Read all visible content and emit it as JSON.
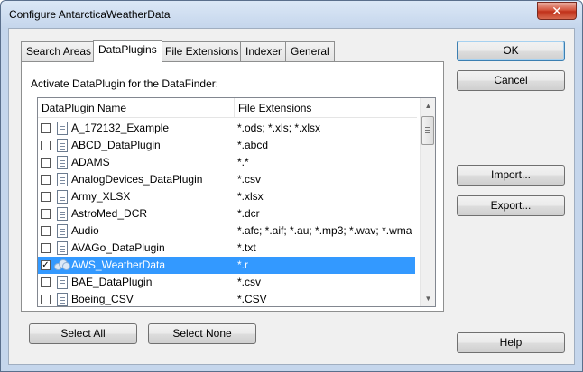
{
  "window": {
    "title": "Configure AntarcticaWeatherData",
    "close_glyph": "✕"
  },
  "tabs": [
    {
      "label": "Search Areas",
      "active": false
    },
    {
      "label": "DataPlugins",
      "active": true
    },
    {
      "label": "File Extensions",
      "active": false
    },
    {
      "label": "Indexer",
      "active": false
    },
    {
      "label": "General",
      "active": false
    }
  ],
  "panel": {
    "label": "Activate DataPlugin for the DataFinder:",
    "columns": {
      "name": "DataPlugin Name",
      "extensions": "File Extensions"
    },
    "rows": [
      {
        "name": "A_172132_Example",
        "ext": "*.ods; *.xls; *.xlsx",
        "checked": false,
        "selected": false,
        "icon": "document-icon"
      },
      {
        "name": "ABCD_DataPlugin",
        "ext": "*.abcd",
        "checked": false,
        "selected": false,
        "icon": "document-icon"
      },
      {
        "name": "ADAMS",
        "ext": "*.*",
        "checked": false,
        "selected": false,
        "icon": "document-icon"
      },
      {
        "name": "AnalogDevices_DataPlugin",
        "ext": "*.csv",
        "checked": false,
        "selected": false,
        "icon": "document-icon"
      },
      {
        "name": "Army_XLSX",
        "ext": "*.xlsx",
        "checked": false,
        "selected": false,
        "icon": "document-icon"
      },
      {
        "name": "AstroMed_DCR",
        "ext": "*.dcr",
        "checked": false,
        "selected": false,
        "icon": "document-icon"
      },
      {
        "name": "Audio",
        "ext": "*.afc; *.aif; *.au; *.mp3; *.wav; *.wma",
        "checked": false,
        "selected": false,
        "icon": "document-icon"
      },
      {
        "name": "AVAGo_DataPlugin",
        "ext": "*.txt",
        "checked": false,
        "selected": false,
        "icon": "document-icon"
      },
      {
        "name": "AWS_WeatherData",
        "ext": "*.r",
        "checked": true,
        "selected": true,
        "icon": "cloud-icon"
      },
      {
        "name": "BAE_DataPlugin",
        "ext": "*.csv",
        "checked": false,
        "selected": false,
        "icon": "document-icon"
      },
      {
        "name": "Boeing_CSV",
        "ext": "*.CSV",
        "checked": false,
        "selected": false,
        "icon": "document-icon"
      }
    ]
  },
  "buttons": {
    "ok": "OK",
    "cancel": "Cancel",
    "import": "Import...",
    "export": "Export...",
    "help": "Help",
    "select_all": "Select All",
    "select_none": "Select None"
  },
  "checkmark_glyph": "✓",
  "scroll_up_glyph": "▲",
  "scroll_down_glyph": "▼"
}
